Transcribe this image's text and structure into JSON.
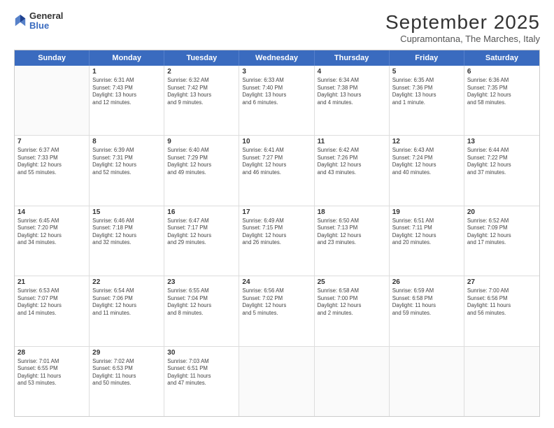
{
  "header": {
    "logo_line1": "General",
    "logo_line2": "Blue",
    "month": "September 2025",
    "location": "Cupramontana, The Marches, Italy"
  },
  "weekdays": [
    "Sunday",
    "Monday",
    "Tuesday",
    "Wednesday",
    "Thursday",
    "Friday",
    "Saturday"
  ],
  "weeks": [
    [
      {
        "day": "",
        "info": ""
      },
      {
        "day": "1",
        "info": "Sunrise: 6:31 AM\nSunset: 7:43 PM\nDaylight: 13 hours\nand 12 minutes."
      },
      {
        "day": "2",
        "info": "Sunrise: 6:32 AM\nSunset: 7:42 PM\nDaylight: 13 hours\nand 9 minutes."
      },
      {
        "day": "3",
        "info": "Sunrise: 6:33 AM\nSunset: 7:40 PM\nDaylight: 13 hours\nand 6 minutes."
      },
      {
        "day": "4",
        "info": "Sunrise: 6:34 AM\nSunset: 7:38 PM\nDaylight: 13 hours\nand 4 minutes."
      },
      {
        "day": "5",
        "info": "Sunrise: 6:35 AM\nSunset: 7:36 PM\nDaylight: 13 hours\nand 1 minute."
      },
      {
        "day": "6",
        "info": "Sunrise: 6:36 AM\nSunset: 7:35 PM\nDaylight: 12 hours\nand 58 minutes."
      }
    ],
    [
      {
        "day": "7",
        "info": "Sunrise: 6:37 AM\nSunset: 7:33 PM\nDaylight: 12 hours\nand 55 minutes."
      },
      {
        "day": "8",
        "info": "Sunrise: 6:39 AM\nSunset: 7:31 PM\nDaylight: 12 hours\nand 52 minutes."
      },
      {
        "day": "9",
        "info": "Sunrise: 6:40 AM\nSunset: 7:29 PM\nDaylight: 12 hours\nand 49 minutes."
      },
      {
        "day": "10",
        "info": "Sunrise: 6:41 AM\nSunset: 7:27 PM\nDaylight: 12 hours\nand 46 minutes."
      },
      {
        "day": "11",
        "info": "Sunrise: 6:42 AM\nSunset: 7:26 PM\nDaylight: 12 hours\nand 43 minutes."
      },
      {
        "day": "12",
        "info": "Sunrise: 6:43 AM\nSunset: 7:24 PM\nDaylight: 12 hours\nand 40 minutes."
      },
      {
        "day": "13",
        "info": "Sunrise: 6:44 AM\nSunset: 7:22 PM\nDaylight: 12 hours\nand 37 minutes."
      }
    ],
    [
      {
        "day": "14",
        "info": "Sunrise: 6:45 AM\nSunset: 7:20 PM\nDaylight: 12 hours\nand 34 minutes."
      },
      {
        "day": "15",
        "info": "Sunrise: 6:46 AM\nSunset: 7:18 PM\nDaylight: 12 hours\nand 32 minutes."
      },
      {
        "day": "16",
        "info": "Sunrise: 6:47 AM\nSunset: 7:17 PM\nDaylight: 12 hours\nand 29 minutes."
      },
      {
        "day": "17",
        "info": "Sunrise: 6:49 AM\nSunset: 7:15 PM\nDaylight: 12 hours\nand 26 minutes."
      },
      {
        "day": "18",
        "info": "Sunrise: 6:50 AM\nSunset: 7:13 PM\nDaylight: 12 hours\nand 23 minutes."
      },
      {
        "day": "19",
        "info": "Sunrise: 6:51 AM\nSunset: 7:11 PM\nDaylight: 12 hours\nand 20 minutes."
      },
      {
        "day": "20",
        "info": "Sunrise: 6:52 AM\nSunset: 7:09 PM\nDaylight: 12 hours\nand 17 minutes."
      }
    ],
    [
      {
        "day": "21",
        "info": "Sunrise: 6:53 AM\nSunset: 7:07 PM\nDaylight: 12 hours\nand 14 minutes."
      },
      {
        "day": "22",
        "info": "Sunrise: 6:54 AM\nSunset: 7:06 PM\nDaylight: 12 hours\nand 11 minutes."
      },
      {
        "day": "23",
        "info": "Sunrise: 6:55 AM\nSunset: 7:04 PM\nDaylight: 12 hours\nand 8 minutes."
      },
      {
        "day": "24",
        "info": "Sunrise: 6:56 AM\nSunset: 7:02 PM\nDaylight: 12 hours\nand 5 minutes."
      },
      {
        "day": "25",
        "info": "Sunrise: 6:58 AM\nSunset: 7:00 PM\nDaylight: 12 hours\nand 2 minutes."
      },
      {
        "day": "26",
        "info": "Sunrise: 6:59 AM\nSunset: 6:58 PM\nDaylight: 11 hours\nand 59 minutes."
      },
      {
        "day": "27",
        "info": "Sunrise: 7:00 AM\nSunset: 6:56 PM\nDaylight: 11 hours\nand 56 minutes."
      }
    ],
    [
      {
        "day": "28",
        "info": "Sunrise: 7:01 AM\nSunset: 6:55 PM\nDaylight: 11 hours\nand 53 minutes."
      },
      {
        "day": "29",
        "info": "Sunrise: 7:02 AM\nSunset: 6:53 PM\nDaylight: 11 hours\nand 50 minutes."
      },
      {
        "day": "30",
        "info": "Sunrise: 7:03 AM\nSunset: 6:51 PM\nDaylight: 11 hours\nand 47 minutes."
      },
      {
        "day": "",
        "info": ""
      },
      {
        "day": "",
        "info": ""
      },
      {
        "day": "",
        "info": ""
      },
      {
        "day": "",
        "info": ""
      }
    ]
  ]
}
